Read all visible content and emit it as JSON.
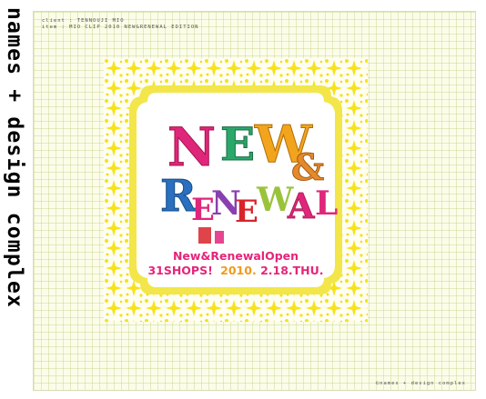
{
  "sidebar": {
    "title": "names + design complex"
  },
  "meta": {
    "client_line": "client : TENNOUJI MIO",
    "item_line": "item : MIO CLIP 2010 NEW&RENEWAL EDITION"
  },
  "artwork": {
    "headline_new": [
      "N",
      "E",
      "W"
    ],
    "headline_amp": "&",
    "headline_renewal": [
      "R",
      "E",
      "N",
      "E",
      "W",
      "A",
      "L"
    ],
    "caption_line1": "New&RenewalOpen",
    "caption_line2_shops": "31SHOPS!",
    "caption_line2_date": "2010.",
    "caption_line2_day": "2.18.THU.",
    "colors": {
      "pattern": "#f7e21b",
      "frame": "#f2e64a",
      "caption_pink": "#e5257a",
      "caption_orange": "#f29a1c",
      "n": "#e0267b",
      "e1": "#2aa86a",
      "w": "#f2a51c",
      "amp": "#e58a2a",
      "r": "#2a6fc0",
      "renewal_other": "#e0267b"
    }
  },
  "footer": {
    "credit": "©names + design complex"
  }
}
